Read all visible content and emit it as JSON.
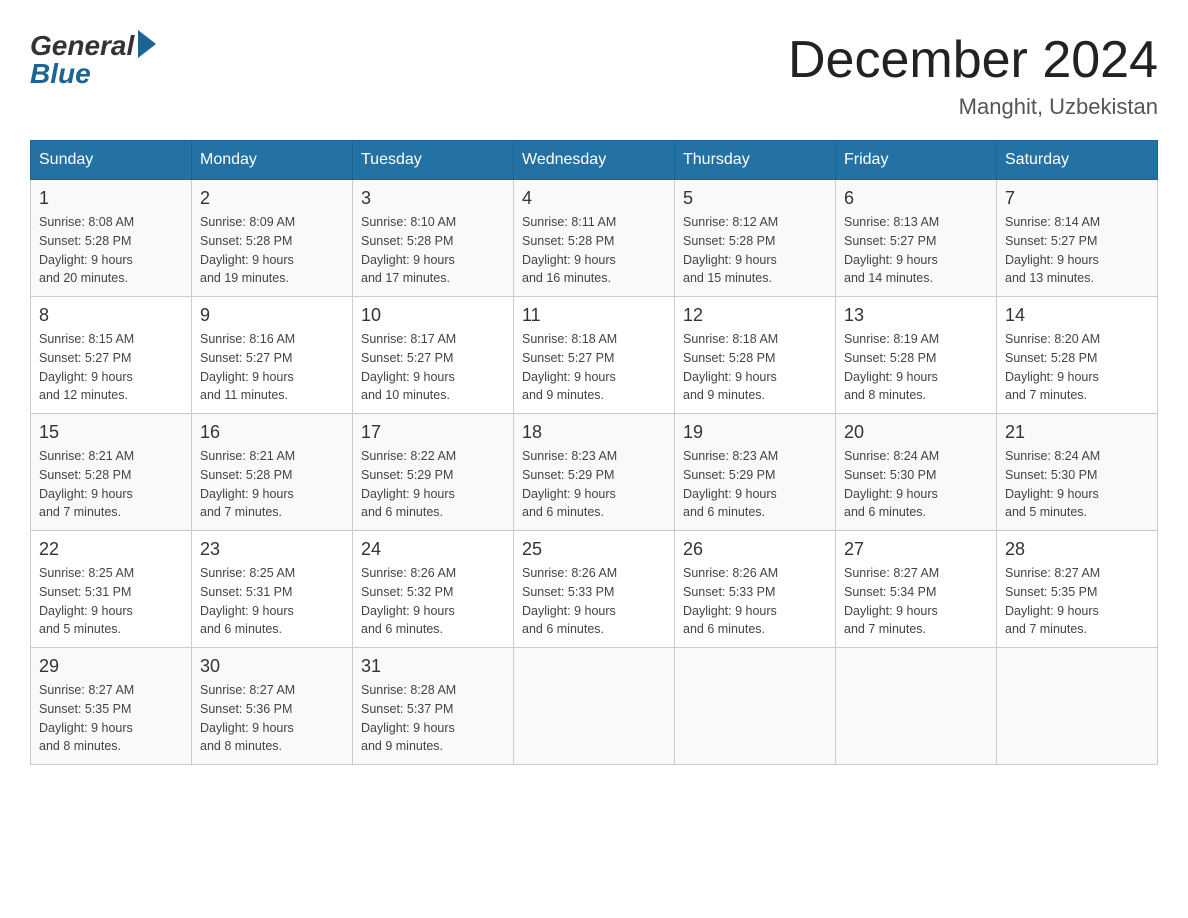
{
  "logo": {
    "general": "General",
    "blue": "Blue"
  },
  "title": "December 2024",
  "subtitle": "Manghit, Uzbekistan",
  "days_of_week": [
    "Sunday",
    "Monday",
    "Tuesday",
    "Wednesday",
    "Thursday",
    "Friday",
    "Saturday"
  ],
  "weeks": [
    [
      {
        "day": "1",
        "sunrise": "8:08 AM",
        "sunset": "5:28 PM",
        "daylight": "9 hours and 20 minutes."
      },
      {
        "day": "2",
        "sunrise": "8:09 AM",
        "sunset": "5:28 PM",
        "daylight": "9 hours and 19 minutes."
      },
      {
        "day": "3",
        "sunrise": "8:10 AM",
        "sunset": "5:28 PM",
        "daylight": "9 hours and 17 minutes."
      },
      {
        "day": "4",
        "sunrise": "8:11 AM",
        "sunset": "5:28 PM",
        "daylight": "9 hours and 16 minutes."
      },
      {
        "day": "5",
        "sunrise": "8:12 AM",
        "sunset": "5:28 PM",
        "daylight": "9 hours and 15 minutes."
      },
      {
        "day": "6",
        "sunrise": "8:13 AM",
        "sunset": "5:27 PM",
        "daylight": "9 hours and 14 minutes."
      },
      {
        "day": "7",
        "sunrise": "8:14 AM",
        "sunset": "5:27 PM",
        "daylight": "9 hours and 13 minutes."
      }
    ],
    [
      {
        "day": "8",
        "sunrise": "8:15 AM",
        "sunset": "5:27 PM",
        "daylight": "9 hours and 12 minutes."
      },
      {
        "day": "9",
        "sunrise": "8:16 AM",
        "sunset": "5:27 PM",
        "daylight": "9 hours and 11 minutes."
      },
      {
        "day": "10",
        "sunrise": "8:17 AM",
        "sunset": "5:27 PM",
        "daylight": "9 hours and 10 minutes."
      },
      {
        "day": "11",
        "sunrise": "8:18 AM",
        "sunset": "5:27 PM",
        "daylight": "9 hours and 9 minutes."
      },
      {
        "day": "12",
        "sunrise": "8:18 AM",
        "sunset": "5:28 PM",
        "daylight": "9 hours and 9 minutes."
      },
      {
        "day": "13",
        "sunrise": "8:19 AM",
        "sunset": "5:28 PM",
        "daylight": "9 hours and 8 minutes."
      },
      {
        "day": "14",
        "sunrise": "8:20 AM",
        "sunset": "5:28 PM",
        "daylight": "9 hours and 7 minutes."
      }
    ],
    [
      {
        "day": "15",
        "sunrise": "8:21 AM",
        "sunset": "5:28 PM",
        "daylight": "9 hours and 7 minutes."
      },
      {
        "day": "16",
        "sunrise": "8:21 AM",
        "sunset": "5:28 PM",
        "daylight": "9 hours and 7 minutes."
      },
      {
        "day": "17",
        "sunrise": "8:22 AM",
        "sunset": "5:29 PM",
        "daylight": "9 hours and 6 minutes."
      },
      {
        "day": "18",
        "sunrise": "8:23 AM",
        "sunset": "5:29 PM",
        "daylight": "9 hours and 6 minutes."
      },
      {
        "day": "19",
        "sunrise": "8:23 AM",
        "sunset": "5:29 PM",
        "daylight": "9 hours and 6 minutes."
      },
      {
        "day": "20",
        "sunrise": "8:24 AM",
        "sunset": "5:30 PM",
        "daylight": "9 hours and 6 minutes."
      },
      {
        "day": "21",
        "sunrise": "8:24 AM",
        "sunset": "5:30 PM",
        "daylight": "9 hours and 5 minutes."
      }
    ],
    [
      {
        "day": "22",
        "sunrise": "8:25 AM",
        "sunset": "5:31 PM",
        "daylight": "9 hours and 5 minutes."
      },
      {
        "day": "23",
        "sunrise": "8:25 AM",
        "sunset": "5:31 PM",
        "daylight": "9 hours and 6 minutes."
      },
      {
        "day": "24",
        "sunrise": "8:26 AM",
        "sunset": "5:32 PM",
        "daylight": "9 hours and 6 minutes."
      },
      {
        "day": "25",
        "sunrise": "8:26 AM",
        "sunset": "5:33 PM",
        "daylight": "9 hours and 6 minutes."
      },
      {
        "day": "26",
        "sunrise": "8:26 AM",
        "sunset": "5:33 PM",
        "daylight": "9 hours and 6 minutes."
      },
      {
        "day": "27",
        "sunrise": "8:27 AM",
        "sunset": "5:34 PM",
        "daylight": "9 hours and 7 minutes."
      },
      {
        "day": "28",
        "sunrise": "8:27 AM",
        "sunset": "5:35 PM",
        "daylight": "9 hours and 7 minutes."
      }
    ],
    [
      {
        "day": "29",
        "sunrise": "8:27 AM",
        "sunset": "5:35 PM",
        "daylight": "9 hours and 8 minutes."
      },
      {
        "day": "30",
        "sunrise": "8:27 AM",
        "sunset": "5:36 PM",
        "daylight": "9 hours and 8 minutes."
      },
      {
        "day": "31",
        "sunrise": "8:28 AM",
        "sunset": "5:37 PM",
        "daylight": "9 hours and 9 minutes."
      },
      null,
      null,
      null,
      null
    ]
  ]
}
